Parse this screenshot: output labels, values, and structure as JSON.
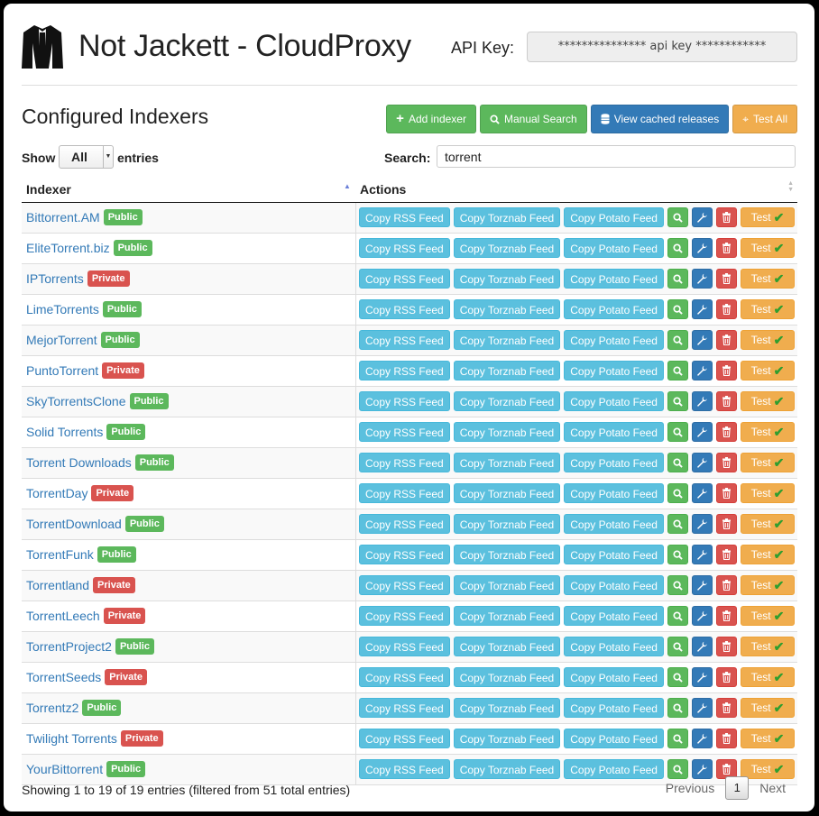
{
  "app": {
    "title": "Not Jackett - CloudProxy",
    "api_key_label": "API Key:",
    "api_key_value": "*************** api key ************"
  },
  "section": {
    "title": "Configured Indexers",
    "buttons": {
      "add": "Add indexer",
      "manual_search": "Manual Search",
      "cached": "View cached releases",
      "test_all": "Test All"
    }
  },
  "controls": {
    "show_label": "Show",
    "show_value": "All",
    "entries_label": "entries",
    "search_label": "Search:",
    "search_value": "torrent"
  },
  "table": {
    "headers": [
      "Indexer",
      "Actions"
    ],
    "action_labels": {
      "rss": "Copy RSS Feed",
      "torznab": "Copy Torznab Feed",
      "potato": "Copy Potato Feed",
      "test": "Test"
    },
    "rows": [
      {
        "name": "Bittorrent.AM",
        "type": "Public"
      },
      {
        "name": "EliteTorrent.biz",
        "type": "Public"
      },
      {
        "name": "IPTorrents",
        "type": "Private"
      },
      {
        "name": "LimeTorrents",
        "type": "Public"
      },
      {
        "name": "MejorTorrent",
        "type": "Public"
      },
      {
        "name": "PuntoTorrent",
        "type": "Private"
      },
      {
        "name": "SkyTorrentsClone",
        "type": "Public"
      },
      {
        "name": "Solid Torrents",
        "type": "Public"
      },
      {
        "name": "Torrent Downloads",
        "type": "Public"
      },
      {
        "name": "TorrentDay",
        "type": "Private"
      },
      {
        "name": "TorrentDownload",
        "type": "Public"
      },
      {
        "name": "TorrentFunk",
        "type": "Public"
      },
      {
        "name": "Torrentland",
        "type": "Private"
      },
      {
        "name": "TorrentLeech",
        "type": "Private"
      },
      {
        "name": "TorrentProject2",
        "type": "Public"
      },
      {
        "name": "TorrentSeeds",
        "type": "Private"
      },
      {
        "name": "Torrentz2",
        "type": "Public"
      },
      {
        "name": "Twilight Torrents",
        "type": "Private"
      },
      {
        "name": "YourBittorrent",
        "type": "Public"
      }
    ]
  },
  "footer": {
    "info": "Showing 1 to 19 of 19 entries (filtered from 51 total entries)",
    "previous": "Previous",
    "page": "1",
    "next": "Next"
  },
  "colors": {
    "success": "#5cb85c",
    "primary": "#337ab7",
    "info": "#5bc0de",
    "warning": "#f0ad4e",
    "danger": "#d9534f"
  }
}
